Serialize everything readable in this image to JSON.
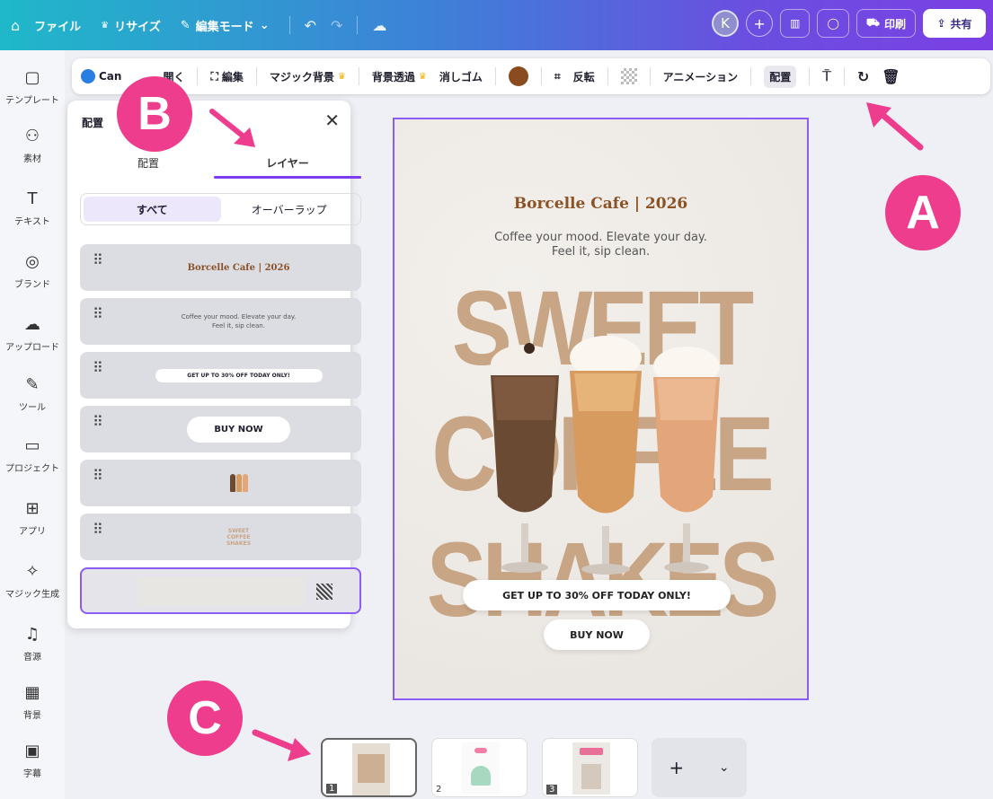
{
  "topbar": {
    "home_icon": "home-icon",
    "file_label": "ファイル",
    "resize_label": "リサイズ",
    "edit_mode_label": "編集モード",
    "avatar_initial": "K",
    "print_label": "印刷",
    "share_label": "共有"
  },
  "context_toolbar": {
    "canva_label": "Can",
    "open_label": "開く",
    "edit_label": "編集",
    "magic_bg_label": "マジック背景",
    "remove_bg_label": "背景透過",
    "eraser_label": "消しゴム",
    "flip_label": "反転",
    "animation_label": "アニメーション",
    "position_label": "配置",
    "color_swatch": "#8a4b1f"
  },
  "sidebar": {
    "items": [
      {
        "label": "テンプレート",
        "icon": "template-icon",
        "glyph": "▢"
      },
      {
        "label": "素材",
        "icon": "elements-icon",
        "glyph": "⚇"
      },
      {
        "label": "テキスト",
        "icon": "text-icon",
        "glyph": "T"
      },
      {
        "label": "ブランド",
        "icon": "brand-icon",
        "glyph": "◎"
      },
      {
        "label": "アップロード",
        "icon": "upload-icon",
        "glyph": "☁"
      },
      {
        "label": "ツール",
        "icon": "tools-icon",
        "glyph": "✎"
      },
      {
        "label": "プロジェクト",
        "icon": "folder-icon",
        "glyph": "▭"
      },
      {
        "label": "アプリ",
        "icon": "apps-icon",
        "glyph": "⊞"
      },
      {
        "label": "マジック生成",
        "icon": "magic-icon",
        "glyph": "✧"
      },
      {
        "label": "音源",
        "icon": "music-icon",
        "glyph": "♫"
      },
      {
        "label": "背景",
        "icon": "background-icon",
        "glyph": "▦"
      },
      {
        "label": "字幕",
        "icon": "captions-icon",
        "glyph": "▣"
      }
    ]
  },
  "panel": {
    "title": "配置",
    "tabs": [
      "配置",
      "レイヤー"
    ],
    "filters": [
      "すべて",
      "オーバーラップ"
    ],
    "layers": {
      "title_text": "Borcelle Cafe | 2026",
      "subtitle_line1": "Coffee your mood. Elevate your day.",
      "subtitle_line2": "Feel it, sip clean.",
      "offer_text": "GET UP TO 30% OFF TODAY ONLY!",
      "buy_text": "BUY NOW",
      "sweet_line1": "SWEET",
      "sweet_line2": "COFFEE",
      "sweet_line3": "SHAKES"
    }
  },
  "canvas": {
    "title": "Borcelle Cafe | 2026",
    "subtitle_line1": "Coffee your mood. Elevate your day.",
    "subtitle_line2": "Feel it, sip clean.",
    "big_line1": "SWEET",
    "big_line2": "COFFEE",
    "big_line3": "SHAKES",
    "offer": "GET UP TO 30% OFF TODAY ONLY!",
    "buy": "BUY NOW"
  },
  "pages": {
    "numbers": [
      "1",
      "2",
      "3"
    ],
    "add": "+",
    "chevron": "⌄"
  },
  "annotations": {
    "a": "A",
    "b": "B",
    "c": "C"
  },
  "colors": {
    "accent": "#7d3cf0",
    "annotation_pink": "#ee3d8c",
    "text_brown": "#8b5226",
    "big_text": "#c7a585"
  }
}
